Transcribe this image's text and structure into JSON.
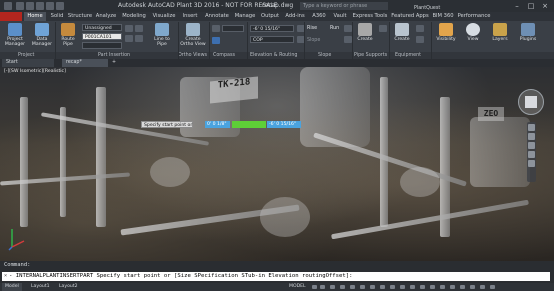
{
  "window": {
    "title": "Autodesk AutoCAD Plant 3D 2016 - NOT FOR RESALE",
    "filename": "recap.dwg",
    "search_placeholder": "Type a keyword or phrase",
    "user": "PlantQuest"
  },
  "ribbon_tabs": [
    "Home",
    "Solid",
    "Structure",
    "Analyze",
    "Modeling",
    "Visualize",
    "Insert",
    "Annotate",
    "Manage",
    "Output",
    "Add-ins",
    "A360",
    "Vault",
    "Express Tools",
    "Featured Apps",
    "BIM 360",
    "Performance"
  ],
  "ribbon": {
    "project": {
      "btn1": "Project Manager",
      "btn2": "Data Manager"
    },
    "part_insertion": {
      "route_pipe": "Route Pipe",
      "combo1": "Unassigned",
      "combo2": "P001CA101",
      "line_to_pipe": "Line to Pipe",
      "create_ortho": "Create Ortho View"
    },
    "compass": {
      "combo": ""
    },
    "elevation": {
      "combo1": "-6' 0 15/16\"",
      "combo2": "COP"
    },
    "slope": {
      "rise": "Rise",
      "run": "Run",
      "slope": "Slope"
    },
    "pipe_supports": {
      "create": "Create"
    },
    "equipment": {
      "create": "Create"
    },
    "visibility": "Visibility",
    "view": "View",
    "layers": "Layers",
    "plugins": "Plugins"
  },
  "panel_labels": [
    "Project",
    "Part Insertion",
    "Ortho Views",
    "Compass",
    "Elevation & Routing",
    "Slope",
    "Pipe Supports",
    "Equipment"
  ],
  "doc_tabs": [
    "Start",
    "recap*"
  ],
  "viewport": {
    "label": "[-][SW Isometric][Realistic]",
    "sign1": "TK-218",
    "sign2": "ZEO"
  },
  "dynamic_input": {
    "prompt": "Specify start point or",
    "field1": "0' 0 1/8\"",
    "field2": "",
    "field3": "-6' 0 15/16\""
  },
  "command": {
    "history_label": "Command:",
    "text": "- INTERNALPLANTINSERTPART Specify start point or [Size SPecification STub-in Elevation routingOffset]:"
  },
  "status": {
    "tabs": [
      "Model",
      "Layout1",
      "Layout2"
    ],
    "mode": "MODEL"
  }
}
